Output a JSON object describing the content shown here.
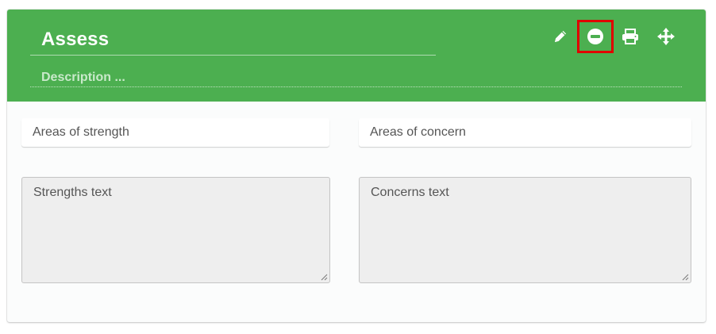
{
  "header": {
    "title": "Assess",
    "description_placeholder": "Description ...",
    "bg_color": "#4caf50",
    "icons": [
      {
        "name": "pencil-icon",
        "action": "edit"
      },
      {
        "name": "minus-circle-icon",
        "action": "remove",
        "highlighted": true
      },
      {
        "name": "print-icon",
        "action": "print"
      },
      {
        "name": "move-arrows-icon",
        "action": "move"
      }
    ]
  },
  "left": {
    "label": "Areas of strength",
    "text": "Strengths text"
  },
  "right": {
    "label": "Areas of concern",
    "text": "Concerns text"
  },
  "colors": {
    "highlight": "#e00000"
  }
}
